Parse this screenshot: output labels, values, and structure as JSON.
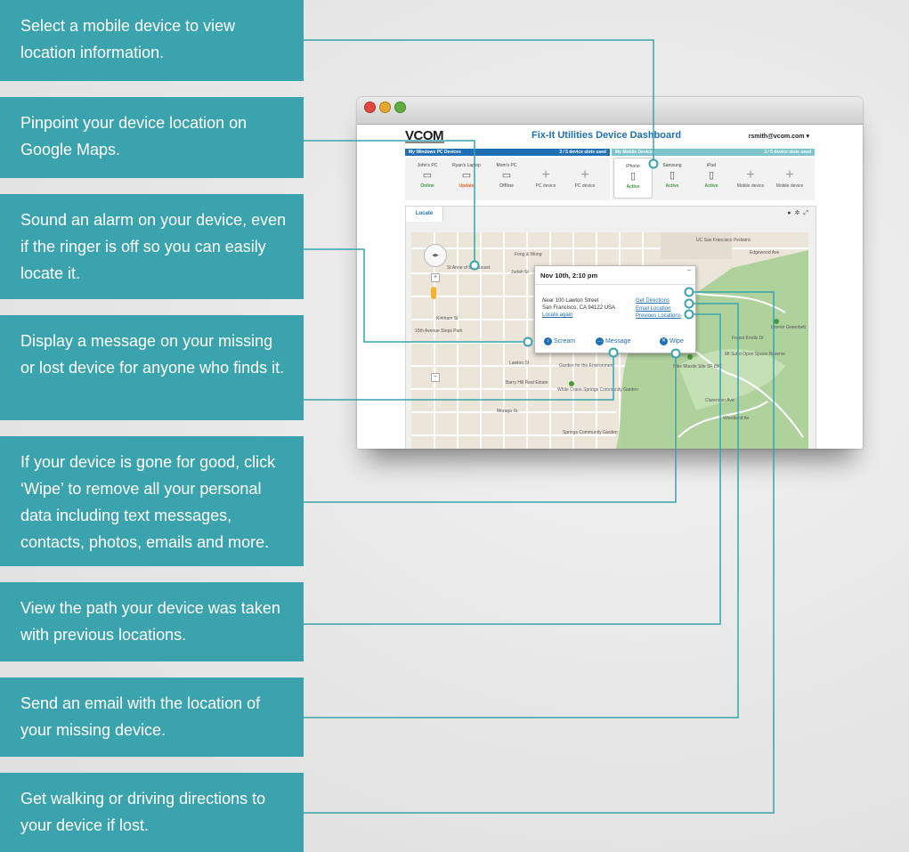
{
  "callouts": [
    "Select a mobile device to view location information.",
    "Pinpoint your device location on Google Maps.",
    "Sound an alarm on your device, even if the ringer is off so you can easily locate it.",
    "Display a message on your missing or lost device for anyone who finds it.",
    "If your device is gone for good, click ‘Wipe’ to remove all your personal data including text messages, contacts, photos, emails and more.",
    "View the path your device was taken with previous locations.",
    "Send an email with the location of your missing device.",
    "Get walking or driving directions to your device if lost."
  ],
  "app": {
    "logo": "VCOM",
    "title": "Fix-It Utilities Device Dashboard",
    "user": "rsmith@vcom.com ▾",
    "pc_group": {
      "label": "My Windows PC Devices",
      "slots": "3 / 5 device slots used"
    },
    "mobile_group": {
      "label": "My Mobile Devices",
      "slots": "3 / 5 device slots used"
    },
    "pc_devices": [
      {
        "name": "John's PC",
        "status": "Online",
        "icon": "laptop-icon"
      },
      {
        "name": "Ryan's Laptop",
        "status": "Update",
        "icon": "laptop-icon"
      },
      {
        "name": "Mom's PC",
        "status": "Offline",
        "icon": "laptop-icon"
      },
      {
        "name": "",
        "status": "PC device",
        "icon": "plus-icon"
      },
      {
        "name": "",
        "status": "PC device",
        "icon": "plus-icon"
      }
    ],
    "mobile_devices": [
      {
        "name": "iPhone",
        "status": "Active",
        "icon": "phone-icon"
      },
      {
        "name": "Samsung",
        "status": "Active",
        "icon": "phone-icon"
      },
      {
        "name": "iPad",
        "status": "Active",
        "icon": "tablet-icon"
      },
      {
        "name": "",
        "status": "Mobile device",
        "icon": "plus-icon"
      },
      {
        "name": "",
        "status": "Mobile device",
        "icon": "plus-icon"
      }
    ],
    "tab": "Locate",
    "tools": [
      "help-icon",
      "gear-icon",
      "expand-icon"
    ],
    "popup": {
      "date": "Nov 10th, 2:10 pm",
      "address_near": "Near",
      "address_line1": "100 Lawton Street",
      "address_line2": "San Francisco, CA 94122 USA",
      "locate_again": "Locate again",
      "get_directions": "Get Directions",
      "email_location": "Email Location",
      "previous_locations": "Previous Locations",
      "scream": "Scream",
      "message": "Message",
      "wipe": "Wipe",
      "close": "–"
    },
    "map_labels": {
      "fong_wong": "Fong & Wong",
      "st_anne": "St Anne of the Sunset",
      "judah": "Judah St",
      "kirkham": "Kirkham St",
      "steps": "15th Avenue Steps Park",
      "lawton": "Lawton St",
      "garden": "Garden for the Environment",
      "barry_hill": "Barry Hill Real Estate",
      "white_crane": "White Crane Springs Community Garden",
      "moraga": "Moraga St",
      "springs": "Springs Community Garden",
      "ucsf": "UC San Francisco Pediatric",
      "interior": "Interior Greenbelt",
      "nike": "Nike Missile Site SF 89C",
      "mt_sutro": "Mt Sutro Open Space Reserve",
      "woodland": "Woodland Av",
      "edgewood": "Edgewood Ave",
      "forest_knolls": "Forest Knolls Dr",
      "clarendon": "Clarendon Ave"
    }
  },
  "colors": {
    "callout_bg": "#3aa3ad",
    "connector": "#3aa3ad",
    "header_blue": "#1f6fb4",
    "active_green": "#3f9a3f",
    "update_orange": "#e8662b"
  }
}
